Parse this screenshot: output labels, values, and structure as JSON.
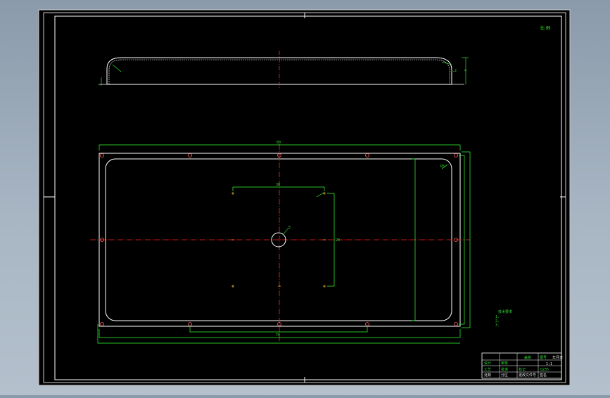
{
  "drawing": {
    "scale_note": "比 例",
    "top_view_dims": {
      "overall_length": "70",
      "height_right": "4",
      "height_right_small": "1.2"
    },
    "front_view_dims": {
      "top_width": "80",
      "inner_width": "30",
      "bottom_width": "70",
      "side_height": "20",
      "center_hole": "5",
      "corner_radius": "R5"
    },
    "tech_notes": [
      "技术要求",
      "1.",
      "2.",
      "3."
    ]
  },
  "title_block": {
    "part_name": "盖板",
    "scale": "1:1",
    "material": "Q235",
    "drawing_no": "图号",
    "labels": [
      "设计",
      "审核",
      "工艺",
      "批准",
      "标记",
      "处数",
      "分区",
      "更改文件号",
      "签名",
      "年月日"
    ]
  },
  "colors": {
    "frame": "#ffffff",
    "dimension": "#33ff33",
    "centerline": "#ff2222",
    "hole": "#ff6666",
    "background": "#000000"
  }
}
